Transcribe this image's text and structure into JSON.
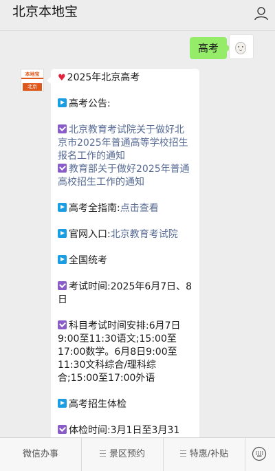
{
  "header": {
    "title": "北京本地宝"
  },
  "chat": {
    "self_message": "高考",
    "bot_avatar": {
      "top": "本地宝",
      "sub": "bendibao.com",
      "bottom": "北京"
    },
    "reply": {
      "title": "2025年北京高考",
      "s1": "高考公告:",
      "l1": "北京教育考试院关于做好北京市2025年普通高等学校招生报名工作的通知",
      "l2": "教育部关于做好2025年普通高校招生工作的通知",
      "s2_label": "高考全指南:",
      "s2_link": "点击查看",
      "s3_label": "官网入口:",
      "s3_link": "北京教育考试院",
      "s4": "全国统考",
      "exam_time": "考试时间:2025年6月7日、8日",
      "schedule": "科目考试时间安排:6月7日9:00至11:30语文;15:00至17:00数学。6月8日9:00至11:30文科综合/理科综合;15:00至17:00外语",
      "s5": "高考招生体检",
      "physical_time": "体检时间:3月1日至3月31"
    }
  },
  "bottom_menu": {
    "item1": "微信办事",
    "item2": "景区预约",
    "item3": "特惠/补贴"
  }
}
